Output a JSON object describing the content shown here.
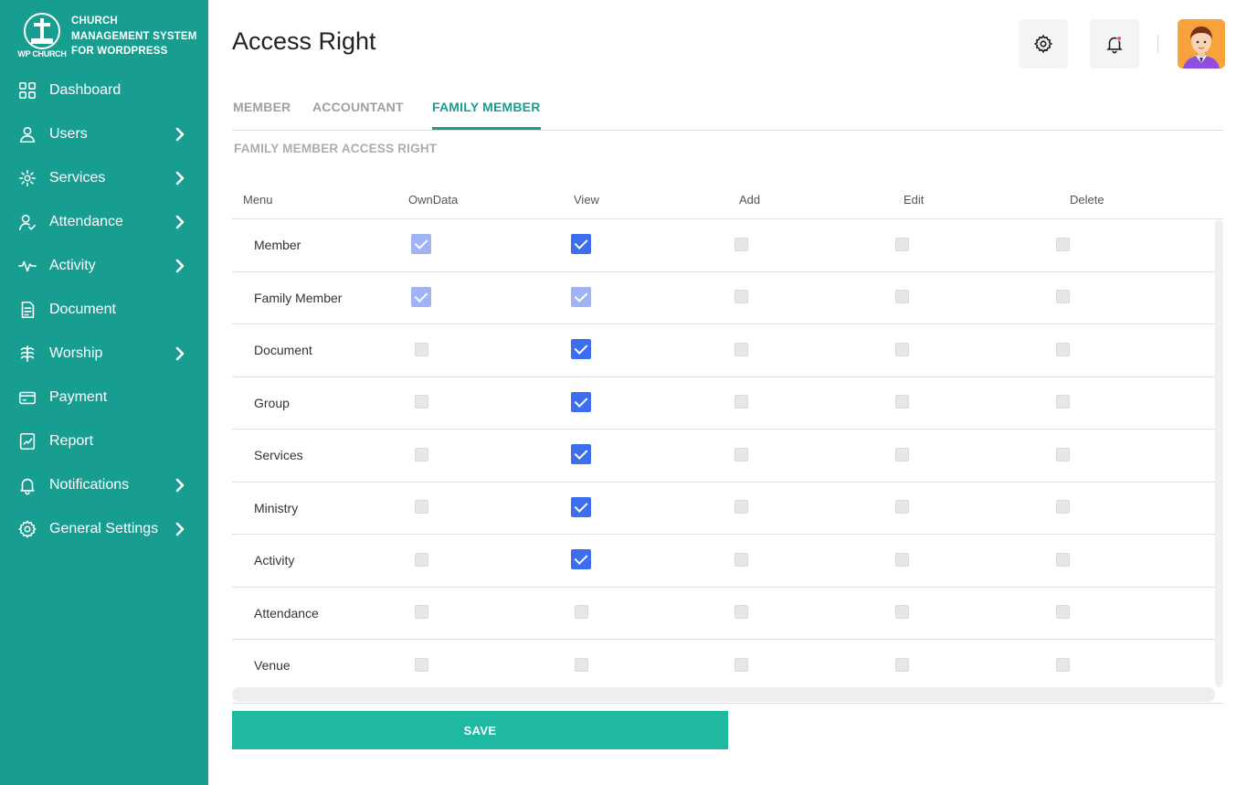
{
  "brand": {
    "logo_text": "WP CHURCH",
    "title": "CHURCH MANAGEMENT SYSTEM FOR WORDPRESS"
  },
  "sidebar": {
    "items": [
      {
        "label": "Dashboard",
        "icon": "dashboard-icon",
        "has_chevron": false
      },
      {
        "label": "Users",
        "icon": "user-icon",
        "has_chevron": true
      },
      {
        "label": "Services",
        "icon": "services-icon",
        "has_chevron": true
      },
      {
        "label": "Attendance",
        "icon": "attendance-icon",
        "has_chevron": true
      },
      {
        "label": "Activity",
        "icon": "activity-icon",
        "has_chevron": true
      },
      {
        "label": "Document",
        "icon": "document-icon",
        "has_chevron": false
      },
      {
        "label": "Worship",
        "icon": "worship-icon",
        "has_chevron": true
      },
      {
        "label": "Payment",
        "icon": "payment-icon",
        "has_chevron": false
      },
      {
        "label": "Report",
        "icon": "report-icon",
        "has_chevron": false
      },
      {
        "label": "Notifications",
        "icon": "bell-icon",
        "has_chevron": true
      },
      {
        "label": "General Settings",
        "icon": "gear-icon",
        "has_chevron": true
      }
    ]
  },
  "header": {
    "title": "Access Right"
  },
  "tabs": [
    {
      "label": "MEMBER",
      "active": false
    },
    {
      "label": "ACCOUNTANT",
      "active": false
    },
    {
      "label": "FAMILY MEMBER",
      "active": true
    }
  ],
  "section_title": "FAMILY MEMBER ACCESS RIGHT",
  "table": {
    "columns": [
      "Menu",
      "OwnData",
      "View",
      "Add",
      "Edit",
      "Delete"
    ],
    "rows": [
      {
        "menu": "Member",
        "perms": [
          "disabled-checked",
          "checked",
          "unchecked",
          "unchecked",
          "unchecked"
        ]
      },
      {
        "menu": "Family Member",
        "perms": [
          "disabled-checked",
          "disabled-checked",
          "unchecked",
          "unchecked",
          "unchecked"
        ]
      },
      {
        "menu": "Document",
        "perms": [
          "unchecked",
          "checked",
          "unchecked",
          "unchecked",
          "unchecked"
        ]
      },
      {
        "menu": "Group",
        "perms": [
          "unchecked",
          "checked",
          "unchecked",
          "unchecked",
          "unchecked"
        ]
      },
      {
        "menu": "Services",
        "perms": [
          "unchecked",
          "checked",
          "unchecked",
          "unchecked",
          "unchecked"
        ]
      },
      {
        "menu": "Ministry",
        "perms": [
          "unchecked",
          "checked",
          "unchecked",
          "unchecked",
          "unchecked"
        ]
      },
      {
        "menu": "Activity",
        "perms": [
          "unchecked",
          "checked",
          "unchecked",
          "unchecked",
          "unchecked"
        ]
      },
      {
        "menu": "Attendance",
        "perms": [
          "unchecked",
          "unchecked",
          "unchecked",
          "unchecked",
          "unchecked"
        ]
      },
      {
        "menu": "Venue",
        "perms": [
          "unchecked",
          "unchecked",
          "unchecked",
          "unchecked",
          "unchecked"
        ]
      }
    ]
  },
  "save_label": "SAVE",
  "colors": {
    "sidebar": "#179e91",
    "accent": "#179e91",
    "checkbox_checked": "#3d6ef0",
    "checkbox_disabled_checked": "#9fb3f5",
    "save_button": "#1fb8a0",
    "notification_dot": "#f0504a"
  }
}
